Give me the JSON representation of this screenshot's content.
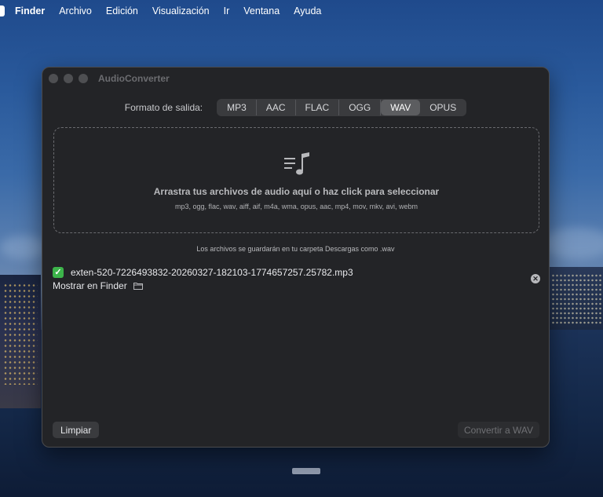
{
  "menubar": {
    "items": [
      "Finder",
      "Archivo",
      "Edición",
      "Visualización",
      "Ir",
      "Ventana",
      "Ayuda"
    ]
  },
  "window": {
    "title": "AudioConverter",
    "format_label": "Formato de salida:",
    "formats": [
      "MP3",
      "AAC",
      "FLAC",
      "OGG",
      "WAV",
      "OPUS"
    ],
    "selected_format": "WAV",
    "dropzone": {
      "icon": "music-list-icon",
      "main_text": "Arrastra tus archivos de audio aquí o haz click para seleccionar",
      "supported_text": "mp3, ogg, flac, wav, aiff, aif, m4a, wma, opus, aac, mp4, mov, mkv, avi, webm"
    },
    "save_note": "Los archivos se guardarán en tu carpeta Descargas como .wav",
    "file": {
      "name": "exten-520-7226493832-20260327-182103-1774657257.25782.mp3",
      "status_icon": "checkmark-icon",
      "show_in_finder": "Mostrar en Finder"
    },
    "buttons": {
      "clear": "Limpiar",
      "convert": "Convertir a WAV"
    }
  },
  "colors": {
    "window_bg": "#232427",
    "selected_segment": "#5c5d60",
    "success": "#3cb44a"
  }
}
